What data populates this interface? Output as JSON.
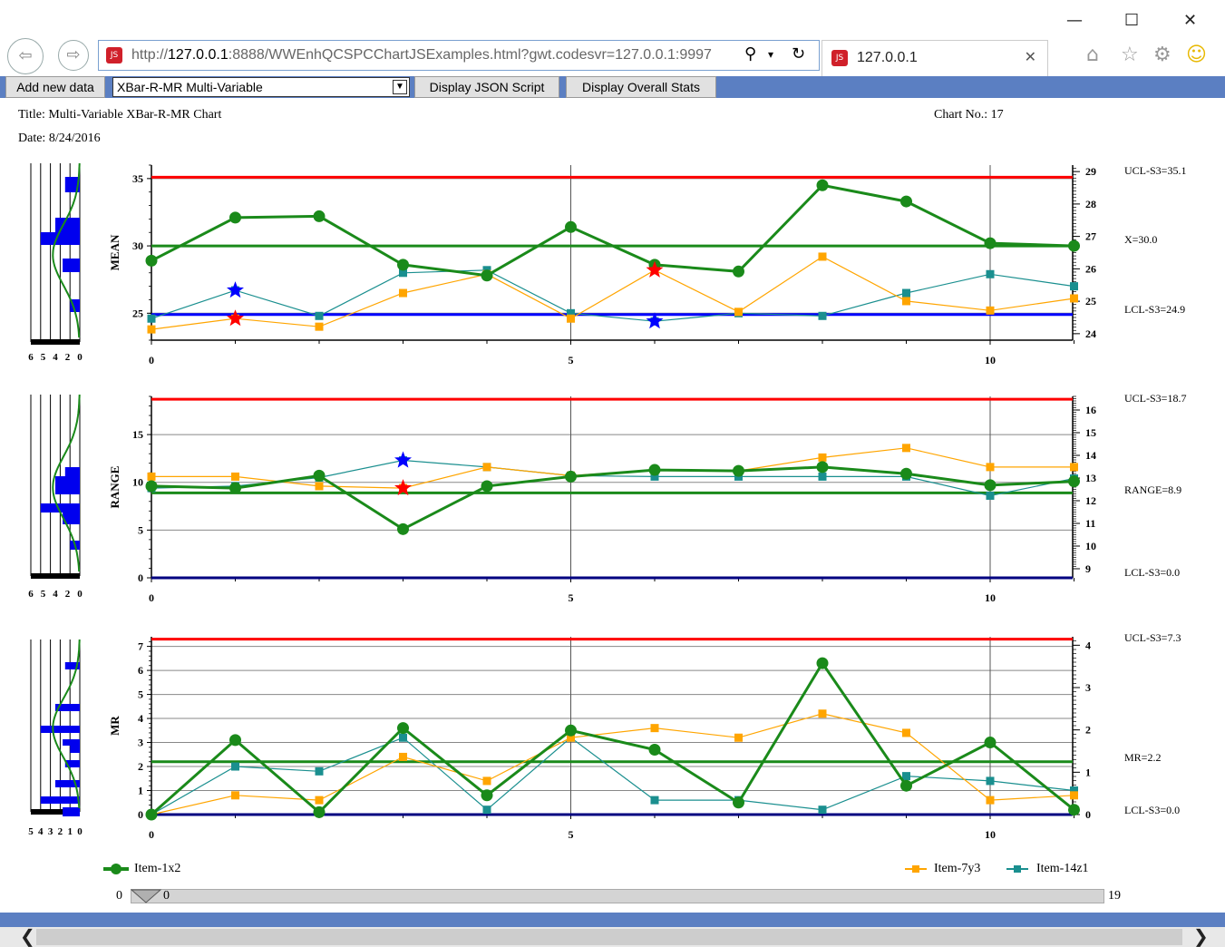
{
  "browser": {
    "url_prefix": "http://",
    "url_host": "127.0.0.1",
    "url_rest": ":8888/WWEnhQCSPCChartJSExamples.html?gwt.codesvr=127.0.0.1:9997",
    "tab_title": "127.0.0.1",
    "favicon_text": "JS"
  },
  "toolbar": {
    "add_label": "Add new data",
    "select_value": "XBar-R-MR Multi-Variable",
    "json_label": "Display JSON Script",
    "stats_label": "Display Overall Stats"
  },
  "header": {
    "title": "Title: Multi-Variable XBar-R-MR Chart",
    "date": "Date: 8/24/2016",
    "chart_no": "Chart No.: 17"
  },
  "colors": {
    "item1": "#1a8a1a",
    "item7": "#ffa500",
    "item14": "#1a8f8f",
    "ucl": "#ff0000",
    "lcl": "#0000ff",
    "center": "#1a8a1a",
    "hist": "#0000ee"
  },
  "slider": {
    "min_label": "0",
    "value_label": "0",
    "max_label": "19"
  },
  "chart_data": [
    {
      "type": "line",
      "ylabel": "MEAN",
      "ylim": [
        23,
        36
      ],
      "ticks": [
        25,
        30,
        35
      ],
      "right_ylim": [
        23.8,
        29.2
      ],
      "right_ticks": [
        24,
        25,
        26,
        27,
        28,
        29
      ],
      "x_ticks": [
        0,
        5,
        10
      ],
      "ucl": 35.1,
      "center": 30.0,
      "lcl": 24.9,
      "limit_labels": [
        "UCL-S3=35.1",
        "X=30.0",
        "LCL-S3=24.9"
      ],
      "hist_ticks": [
        "6",
        "5",
        "4",
        "2",
        "0"
      ],
      "series": [
        {
          "name": "Item-1x2",
          "values": [
            28.9,
            32.1,
            32.2,
            28.6,
            27.8,
            31.4,
            28.6,
            28.1,
            34.5,
            33.3,
            30.2,
            30.0
          ]
        },
        {
          "name": "Item-7y3",
          "values": [
            23.8,
            24.6,
            24.0,
            26.5,
            27.9,
            24.6,
            28.2,
            25.1,
            29.2,
            25.9,
            25.2,
            26.1
          ]
        },
        {
          "name": "Item-14z1",
          "values": [
            24.6,
            26.7,
            24.8,
            28.0,
            28.2,
            25.0,
            24.4,
            25.0,
            24.8,
            26.5,
            27.9,
            27.0
          ]
        }
      ],
      "stars": [
        {
          "x": 1,
          "y": 26.7,
          "color": "#0000ff"
        },
        {
          "x": 1,
          "y": 24.6,
          "color": "#ff0000"
        },
        {
          "x": 6,
          "y": 28.2,
          "color": "#ff0000"
        },
        {
          "x": 6,
          "y": 24.4,
          "color": "#0000ff"
        }
      ]
    },
    {
      "type": "line",
      "ylabel": "RANGE",
      "ylim": [
        0,
        19
      ],
      "ticks": [
        0,
        5,
        10,
        15
      ],
      "right_ylim": [
        8.6,
        16.6
      ],
      "right_ticks": [
        9,
        10,
        11,
        12,
        13,
        14,
        15,
        16
      ],
      "x_ticks": [
        0,
        5,
        10
      ],
      "ucl": 18.7,
      "center": 8.9,
      "lcl": 0.0,
      "limit_labels": [
        "UCL-S3=18.7",
        "RANGE=8.9",
        "LCL-S3=0.0"
      ],
      "hist_ticks": [
        "6",
        "5",
        "4",
        "2",
        "0"
      ],
      "series": [
        {
          "name": "Item-1x2",
          "values": [
            9.6,
            9.4,
            10.7,
            5.1,
            9.6,
            10.6,
            11.3,
            11.2,
            11.6,
            10.9,
            9.7,
            10.1
          ]
        },
        {
          "name": "Item-7y3",
          "values": [
            10.6,
            10.6,
            9.6,
            9.4,
            11.6,
            10.7,
            11.3,
            11.2,
            12.6,
            13.6,
            11.6,
            11.6
          ]
        },
        {
          "name": "Item-14z1",
          "values": [
            9.4,
            9.6,
            10.5,
            12.3,
            11.6,
            10.7,
            10.6,
            10.6,
            10.6,
            10.6,
            8.6,
            10.4
          ]
        }
      ],
      "stars": [
        {
          "x": 3,
          "y": 12.3,
          "color": "#0000ff"
        },
        {
          "x": 3,
          "y": 9.4,
          "color": "#ff0000"
        }
      ]
    },
    {
      "type": "line",
      "ylabel": "MR",
      "ylim": [
        0,
        7.4
      ],
      "ticks": [
        0,
        1,
        2,
        3,
        4,
        5,
        6,
        7
      ],
      "right_ylim": [
        0,
        4.2
      ],
      "right_ticks": [
        0,
        1,
        2,
        3,
        4
      ],
      "x_ticks": [
        0,
        5,
        10
      ],
      "ucl": 7.3,
      "center": 2.2,
      "lcl": 0.0,
      "limit_labels": [
        "UCL-S3=7.3",
        "MR=2.2",
        "LCL-S3=0.0"
      ],
      "hist_ticks": [
        "5",
        "4",
        "3",
        "2",
        "1",
        "0"
      ],
      "series": [
        {
          "name": "Item-1x2",
          "values": [
            0.0,
            3.1,
            0.1,
            3.6,
            0.8,
            3.5,
            2.7,
            0.5,
            6.3,
            1.2,
            3.0,
            0.2
          ]
        },
        {
          "name": "Item-7y3",
          "values": [
            0.0,
            0.8,
            0.6,
            2.4,
            1.4,
            3.2,
            3.6,
            3.2,
            4.2,
            3.4,
            0.6,
            0.8
          ]
        },
        {
          "name": "Item-14z1",
          "values": [
            0.0,
            2.0,
            1.8,
            3.2,
            0.2,
            3.2,
            0.6,
            0.6,
            0.2,
            1.6,
            1.4,
            1.0
          ]
        }
      ],
      "stars": []
    }
  ],
  "legend": [
    {
      "name": "Item-1x2",
      "color": "#1a8a1a",
      "marker": "circle"
    },
    {
      "name": "Item-7y3",
      "color": "#ffa500",
      "marker": "square"
    },
    {
      "name": "Item-14z1",
      "color": "#1a8f8f",
      "marker": "square"
    }
  ]
}
